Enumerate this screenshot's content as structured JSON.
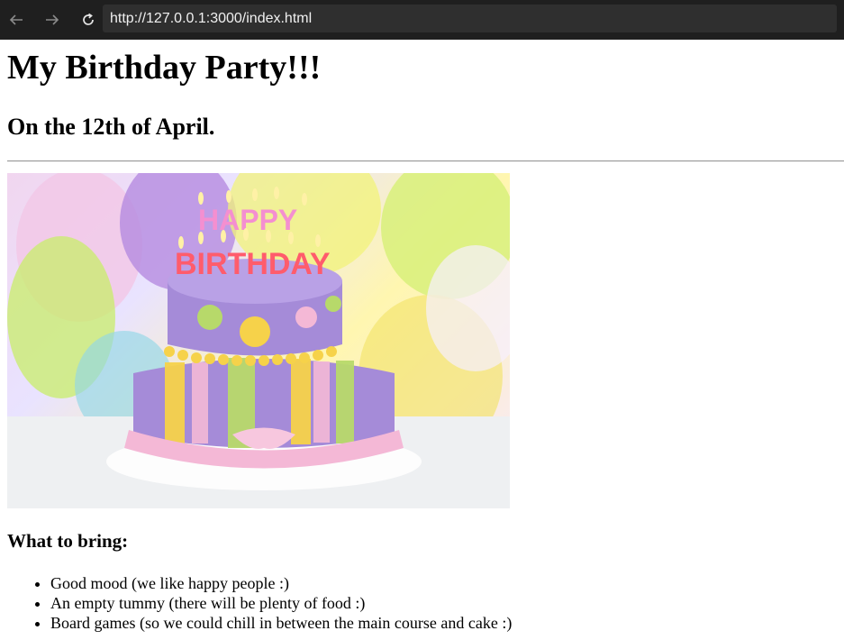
{
  "browser": {
    "url": "http://127.0.0.1:3000/index.html",
    "back_icon": "arrow-left-icon",
    "forward_icon": "arrow-right-icon",
    "reload_icon": "reload-icon"
  },
  "page": {
    "title": "My Birthday Party!!!",
    "subtitle": "On the 12th of April.",
    "image_text_line1": "HAPPY",
    "image_text_line2": "BIRTHDAY",
    "bring_heading": "What to bring:",
    "bring_items": [
      "Good mood (we like happy people :)",
      "An empty tummy (there will be plenty of food :)",
      "Board games (so we could chill in between the main course and cake :)"
    ]
  },
  "colors": {
    "chrome_bg": "#1f1f1f",
    "url_bar_bg": "#2f2f2f",
    "cake_purple": "#a58bd8",
    "cake_pink": "#f4b8d6",
    "cake_yellow": "#f6d24a",
    "cake_green": "#b7d96a"
  }
}
